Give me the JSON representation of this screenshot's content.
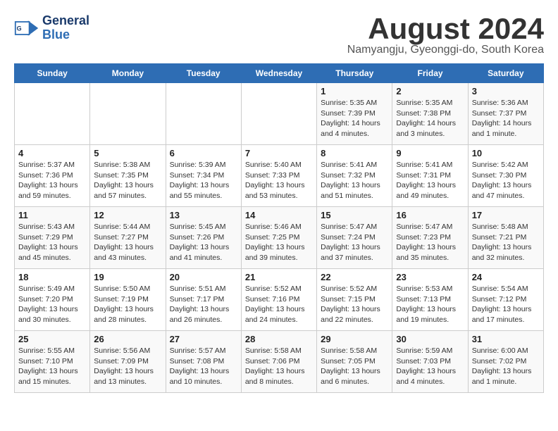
{
  "header": {
    "logo_line1": "General",
    "logo_line2": "Blue",
    "month_year": "August 2024",
    "location": "Namyangju, Gyeonggi-do, South Korea"
  },
  "days_of_week": [
    "Sunday",
    "Monday",
    "Tuesday",
    "Wednesday",
    "Thursday",
    "Friday",
    "Saturday"
  ],
  "weeks": [
    [
      {
        "num": "",
        "info": ""
      },
      {
        "num": "",
        "info": ""
      },
      {
        "num": "",
        "info": ""
      },
      {
        "num": "",
        "info": ""
      },
      {
        "num": "1",
        "info": "Sunrise: 5:35 AM\nSunset: 7:39 PM\nDaylight: 14 hours and 4 minutes."
      },
      {
        "num": "2",
        "info": "Sunrise: 5:35 AM\nSunset: 7:38 PM\nDaylight: 14 hours and 3 minutes."
      },
      {
        "num": "3",
        "info": "Sunrise: 5:36 AM\nSunset: 7:37 PM\nDaylight: 14 hours and 1 minute."
      }
    ],
    [
      {
        "num": "4",
        "info": "Sunrise: 5:37 AM\nSunset: 7:36 PM\nDaylight: 13 hours and 59 minutes."
      },
      {
        "num": "5",
        "info": "Sunrise: 5:38 AM\nSunset: 7:35 PM\nDaylight: 13 hours and 57 minutes."
      },
      {
        "num": "6",
        "info": "Sunrise: 5:39 AM\nSunset: 7:34 PM\nDaylight: 13 hours and 55 minutes."
      },
      {
        "num": "7",
        "info": "Sunrise: 5:40 AM\nSunset: 7:33 PM\nDaylight: 13 hours and 53 minutes."
      },
      {
        "num": "8",
        "info": "Sunrise: 5:41 AM\nSunset: 7:32 PM\nDaylight: 13 hours and 51 minutes."
      },
      {
        "num": "9",
        "info": "Sunrise: 5:41 AM\nSunset: 7:31 PM\nDaylight: 13 hours and 49 minutes."
      },
      {
        "num": "10",
        "info": "Sunrise: 5:42 AM\nSunset: 7:30 PM\nDaylight: 13 hours and 47 minutes."
      }
    ],
    [
      {
        "num": "11",
        "info": "Sunrise: 5:43 AM\nSunset: 7:29 PM\nDaylight: 13 hours and 45 minutes."
      },
      {
        "num": "12",
        "info": "Sunrise: 5:44 AM\nSunset: 7:27 PM\nDaylight: 13 hours and 43 minutes."
      },
      {
        "num": "13",
        "info": "Sunrise: 5:45 AM\nSunset: 7:26 PM\nDaylight: 13 hours and 41 minutes."
      },
      {
        "num": "14",
        "info": "Sunrise: 5:46 AM\nSunset: 7:25 PM\nDaylight: 13 hours and 39 minutes."
      },
      {
        "num": "15",
        "info": "Sunrise: 5:47 AM\nSunset: 7:24 PM\nDaylight: 13 hours and 37 minutes."
      },
      {
        "num": "16",
        "info": "Sunrise: 5:47 AM\nSunset: 7:23 PM\nDaylight: 13 hours and 35 minutes."
      },
      {
        "num": "17",
        "info": "Sunrise: 5:48 AM\nSunset: 7:21 PM\nDaylight: 13 hours and 32 minutes."
      }
    ],
    [
      {
        "num": "18",
        "info": "Sunrise: 5:49 AM\nSunset: 7:20 PM\nDaylight: 13 hours and 30 minutes."
      },
      {
        "num": "19",
        "info": "Sunrise: 5:50 AM\nSunset: 7:19 PM\nDaylight: 13 hours and 28 minutes."
      },
      {
        "num": "20",
        "info": "Sunrise: 5:51 AM\nSunset: 7:17 PM\nDaylight: 13 hours and 26 minutes."
      },
      {
        "num": "21",
        "info": "Sunrise: 5:52 AM\nSunset: 7:16 PM\nDaylight: 13 hours and 24 minutes."
      },
      {
        "num": "22",
        "info": "Sunrise: 5:52 AM\nSunset: 7:15 PM\nDaylight: 13 hours and 22 minutes."
      },
      {
        "num": "23",
        "info": "Sunrise: 5:53 AM\nSunset: 7:13 PM\nDaylight: 13 hours and 19 minutes."
      },
      {
        "num": "24",
        "info": "Sunrise: 5:54 AM\nSunset: 7:12 PM\nDaylight: 13 hours and 17 minutes."
      }
    ],
    [
      {
        "num": "25",
        "info": "Sunrise: 5:55 AM\nSunset: 7:10 PM\nDaylight: 13 hours and 15 minutes."
      },
      {
        "num": "26",
        "info": "Sunrise: 5:56 AM\nSunset: 7:09 PM\nDaylight: 13 hours and 13 minutes."
      },
      {
        "num": "27",
        "info": "Sunrise: 5:57 AM\nSunset: 7:08 PM\nDaylight: 13 hours and 10 minutes."
      },
      {
        "num": "28",
        "info": "Sunrise: 5:58 AM\nSunset: 7:06 PM\nDaylight: 13 hours and 8 minutes."
      },
      {
        "num": "29",
        "info": "Sunrise: 5:58 AM\nSunset: 7:05 PM\nDaylight: 13 hours and 6 minutes."
      },
      {
        "num": "30",
        "info": "Sunrise: 5:59 AM\nSunset: 7:03 PM\nDaylight: 13 hours and 4 minutes."
      },
      {
        "num": "31",
        "info": "Sunrise: 6:00 AM\nSunset: 7:02 PM\nDaylight: 13 hours and 1 minute."
      }
    ]
  ]
}
